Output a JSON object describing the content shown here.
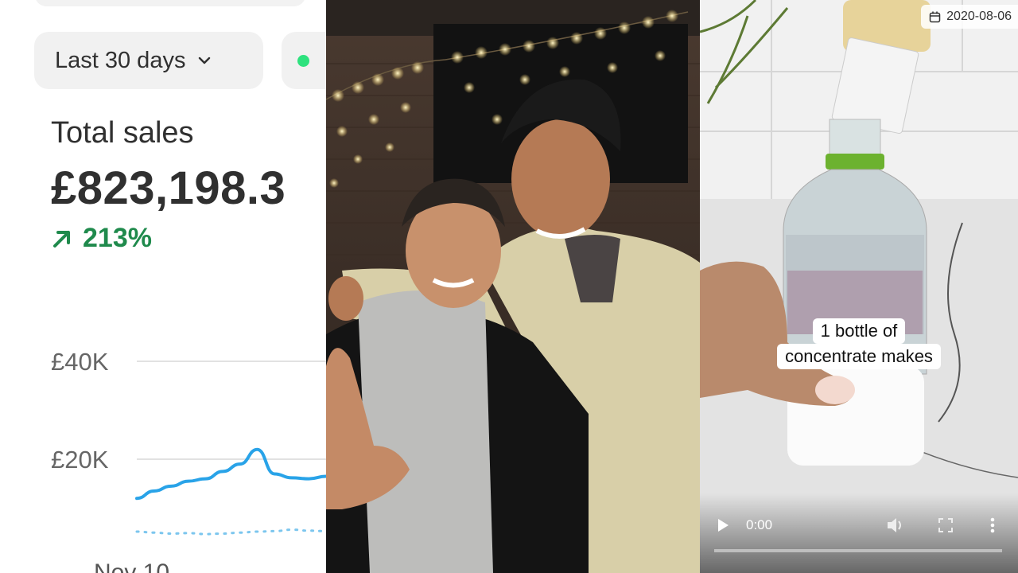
{
  "dashboard": {
    "range_label": "Last 30 days",
    "total_label": "Total sales",
    "total_value": "£823,198.3",
    "change_pct": "213%",
    "date_label": "Nov 10",
    "colors": {
      "positive": "#1f8a4c",
      "series": "#29a3e8",
      "live": "#2ee27e"
    }
  },
  "chart_data": {
    "type": "line",
    "ylabel": "",
    "xlabel": "",
    "ylim": [
      0,
      40000
    ],
    "y_ticks": [
      "£40K",
      "£20K"
    ],
    "y_tick_values": [
      40000,
      20000
    ],
    "grid": true,
    "x": [
      0,
      1,
      2,
      3,
      4,
      5,
      6,
      7,
      8,
      9,
      10,
      11
    ],
    "series": [
      {
        "values": [
          12000,
          13500,
          14500,
          15500,
          16000,
          17500,
          19000,
          22000,
          17000,
          16200,
          16000,
          16500
        ]
      },
      {
        "values": [
          5200,
          5000,
          4800,
          4900,
          4700,
          4800,
          5000,
          5200,
          5300,
          5600,
          5400,
          5300
        ]
      }
    ]
  },
  "video": {
    "date_chip": "2020-08-06",
    "caption_lines": [
      "1 bottle of",
      "concentrate makes"
    ],
    "current_time": "0:00",
    "progress": 0.0,
    "icons": [
      "play-icon",
      "volume-icon",
      "fullscreen-icon",
      "more-vert-icon",
      "calendar-icon"
    ]
  }
}
